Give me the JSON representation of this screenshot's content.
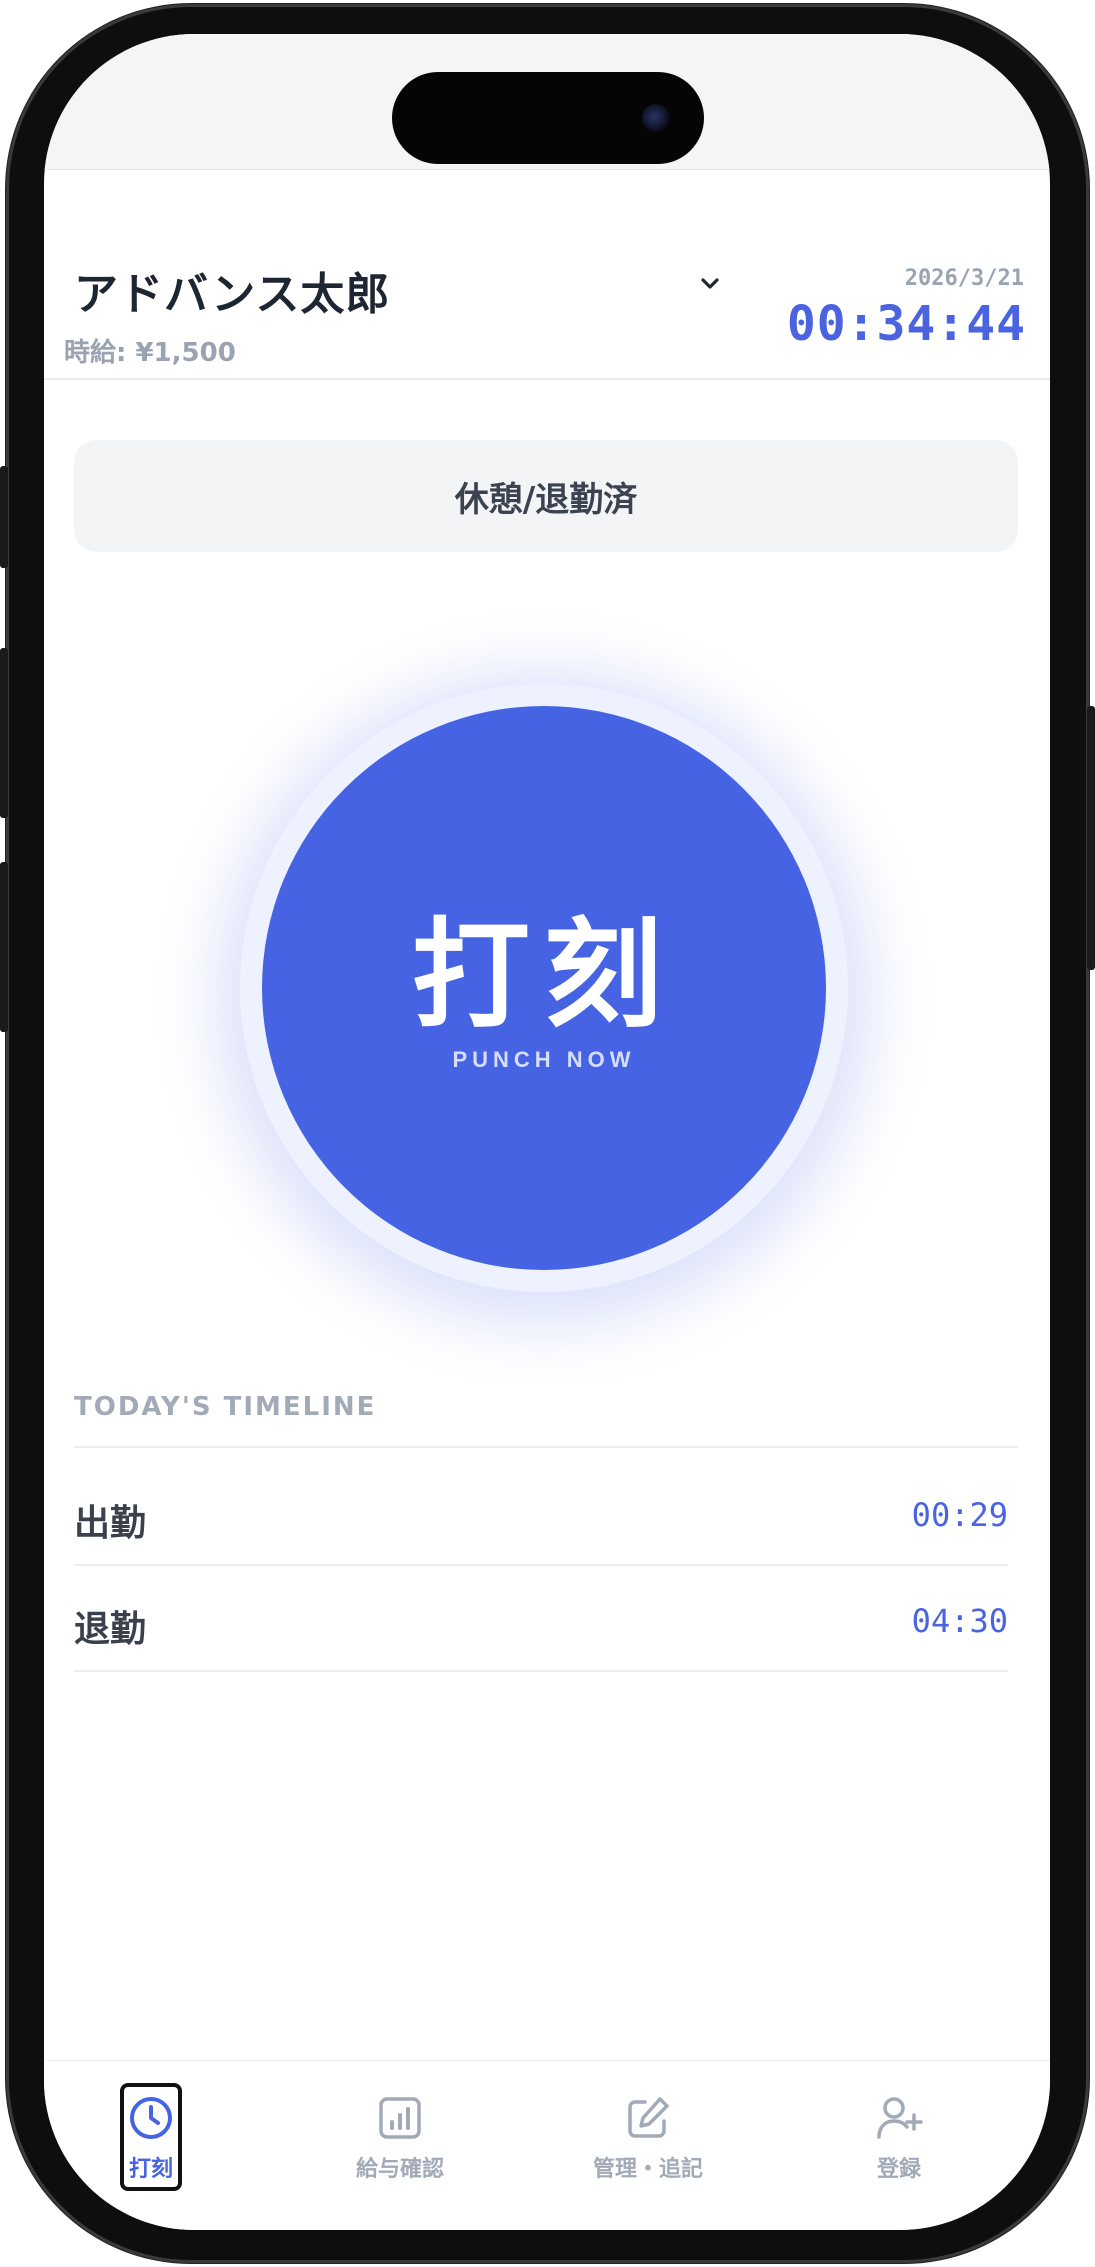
{
  "header": {
    "user_name": "アドバンス太郎",
    "wage": "時給: ¥1,500",
    "date": "2026/3/21",
    "time": "00:34:44"
  },
  "status": {
    "label": "休憩/退勤済"
  },
  "punch": {
    "main_label": "打刻",
    "sub_label": "PUNCH NOW"
  },
  "timeline": {
    "title": "TODAY'S TIMELINE",
    "entries": [
      {
        "label": "出勤",
        "time": "00:29"
      },
      {
        "label": "退勤",
        "time": "04:30"
      }
    ]
  },
  "nav": {
    "items": [
      {
        "label": "打刻",
        "icon": "clock-icon",
        "active": true
      },
      {
        "label": "給与確認",
        "icon": "chart-icon",
        "active": false
      },
      {
        "label": "管理・追記",
        "icon": "edit-icon",
        "active": false
      },
      {
        "label": "登録",
        "icon": "add-user-icon",
        "active": false
      }
    ]
  },
  "colors": {
    "accent": "#4563e3",
    "text_dark": "#1f2633",
    "text_muted": "#9aa3b2"
  }
}
